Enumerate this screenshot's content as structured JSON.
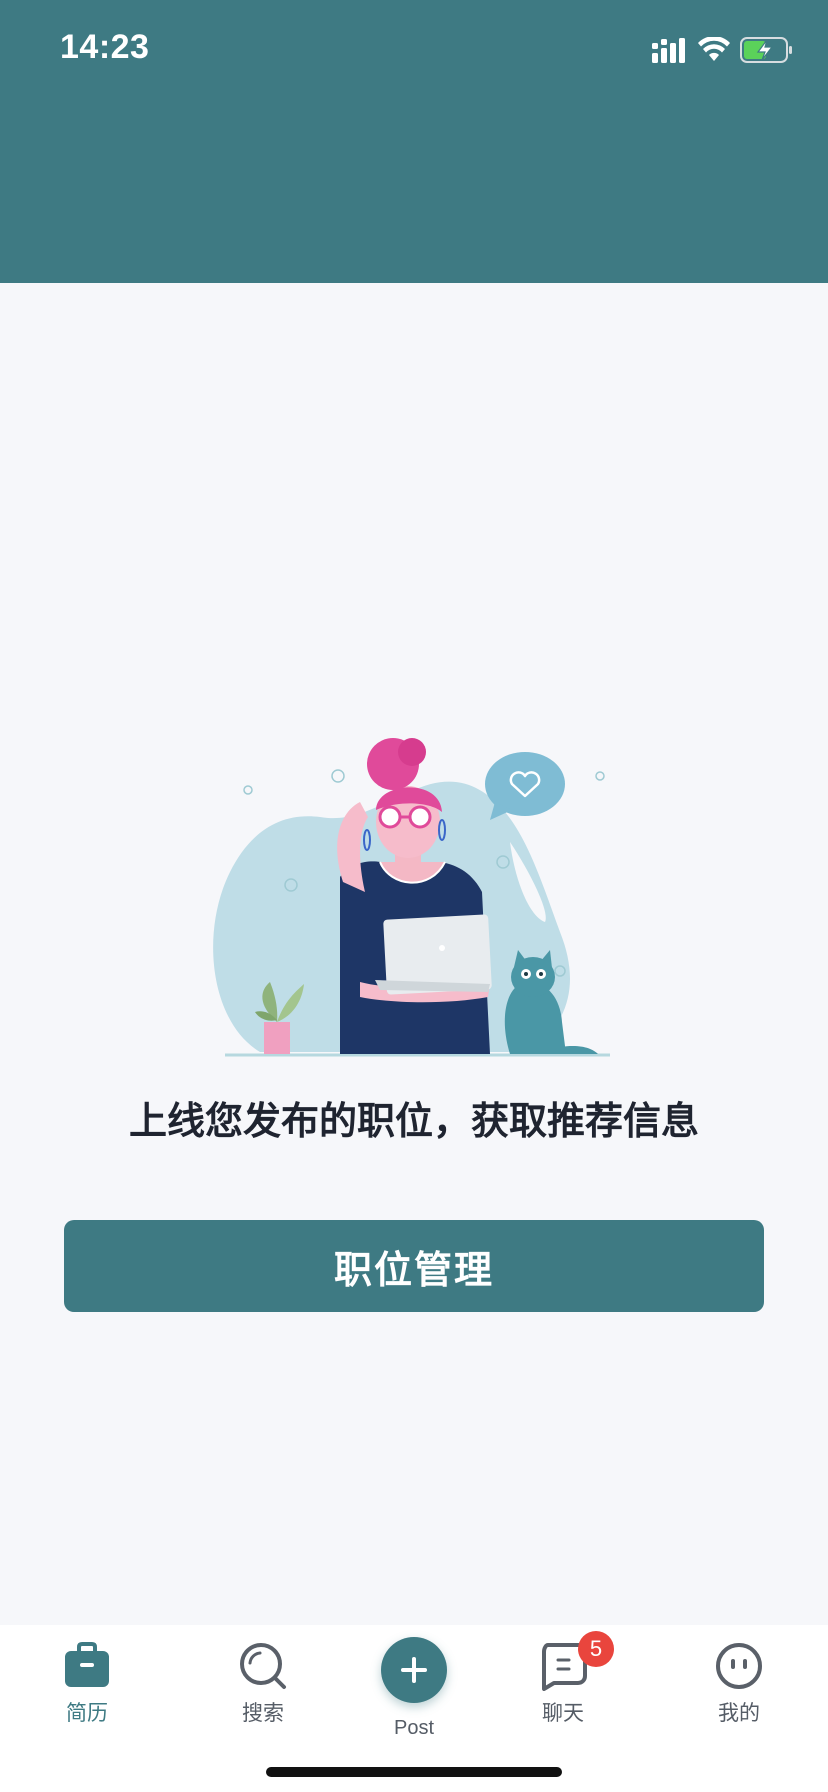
{
  "status_bar": {
    "time": "14:23"
  },
  "main": {
    "message": "上线您发布的职位，获取推荐信息",
    "primary_button": "职位管理"
  },
  "tab_bar": {
    "tabs": [
      {
        "label": "简历",
        "icon": "briefcase-icon",
        "active": true
      },
      {
        "label": "搜索",
        "icon": "search-icon"
      },
      {
        "label": "聊天",
        "icon": "chat-icon",
        "badge": "5"
      },
      {
        "label": "我的",
        "icon": "profile-icon"
      }
    ],
    "post_label": "Post"
  },
  "colors": {
    "primary": "#3e7a83",
    "badge": "#e9453d",
    "background": "#f6f7fa"
  }
}
